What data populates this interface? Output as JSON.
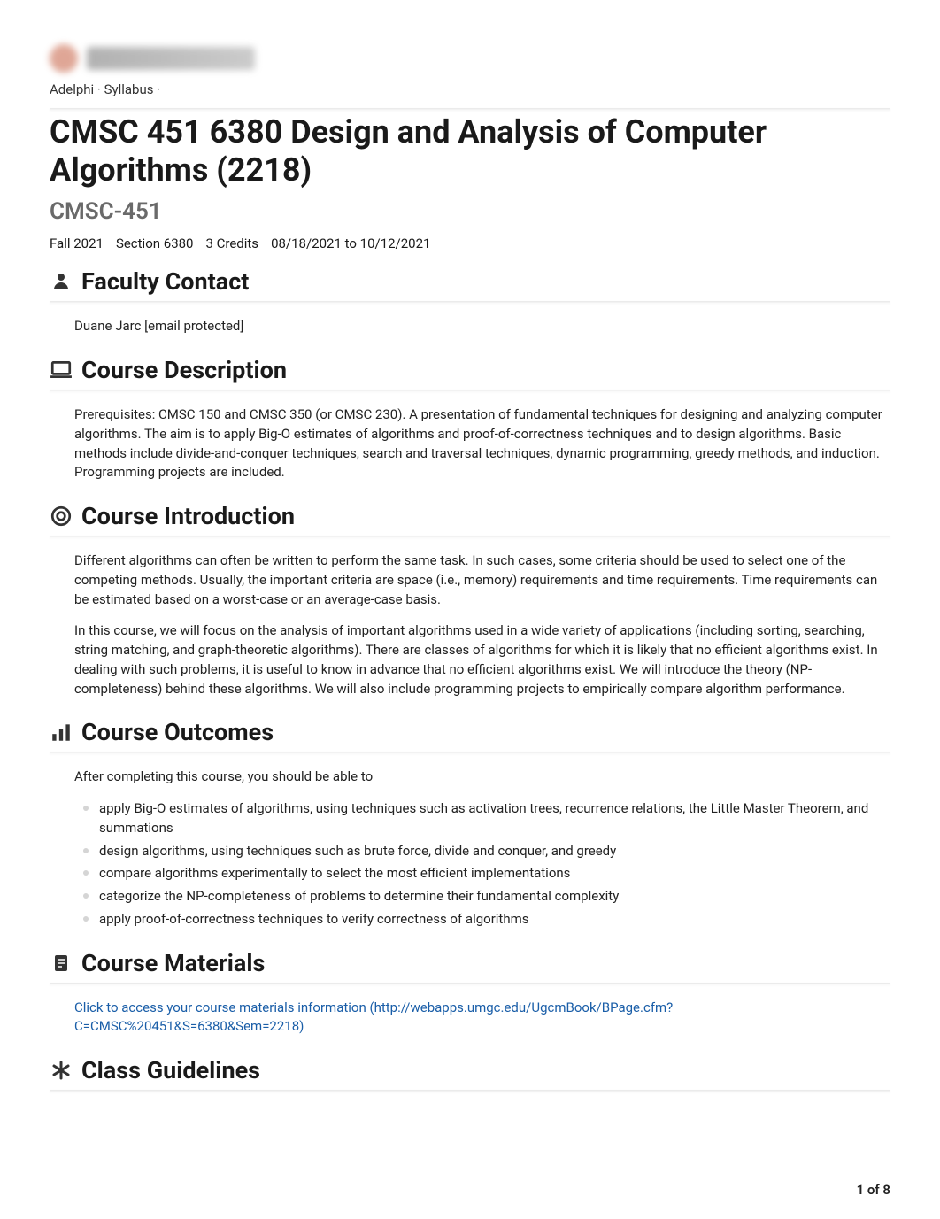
{
  "breadcrumb": {
    "part1": "Adelphi",
    "sep1": " · ",
    "part2": "Syllabus",
    "sep2": " · "
  },
  "header": {
    "course_title": "CMSC 451 6380 Design and Analysis of Computer Algorithms (2218)",
    "course_code": "CMSC-451",
    "term": "Fall 2021",
    "section": "Section 6380",
    "credits": "3 Credits",
    "dates": "08/18/2021 to 10/12/2021"
  },
  "sections": {
    "faculty_contact": {
      "title": "Faculty Contact",
      "body": "Duane Jarc [email protected]"
    },
    "course_description": {
      "title": "Course Description",
      "body": "Prerequisites: CMSC 150 and CMSC 350 (or CMSC 230). A presentation of fundamental techniques for designing and analyzing computer algorithms. The aim is to apply Big-O estimates of algorithms and proof-of-correctness techniques and to design algorithms. Basic methods include divide-and-conquer techniques, search and traversal techniques, dynamic programming, greedy methods, and induction. Programming projects are included."
    },
    "course_introduction": {
      "title": "Course Introduction",
      "p1": "Different algorithms can often be written to perform the same task. In such cases, some criteria should be used to select one of the competing methods. Usually, the important criteria are space (i.e., memory) requirements and time requirements. Time requirements can be estimated based on a worst-case or an average-case basis.",
      "p2": "In this course, we will focus on the analysis of important algorithms used in a wide variety of applications (including sorting, searching, string matching, and graph-theoretic algorithms). There are classes of algorithms for which it is likely that no efficient algorithms exist. In dealing with such problems, it is useful to know in advance that no efficient algorithms exist. We will introduce the theory (NP-completeness) behind these algorithms. We will also include programming projects to empirically compare algorithm performance."
    },
    "course_outcomes": {
      "title": "Course Outcomes",
      "intro": "After completing this course, you should be able to",
      "items": [
        "apply Big-O estimates of algorithms, using techniques such as activation trees, recurrence relations, the Little Master Theorem, and summations",
        "design algorithms, using techniques such as brute force, divide and conquer, and greedy",
        "compare algorithms experimentally to select the most efficient implementations",
        "categorize the NP-completeness of problems to determine their fundamental complexity",
        "apply proof-of-correctness techniques to verify correctness of algorithms"
      ]
    },
    "course_materials": {
      "title": "Course Materials",
      "link_text": "Click to access your course materials information (http://webapps.umgc.edu/UgcmBook/BPage.cfm?C=CMSC%20451&S=6380&Sem=2218)"
    },
    "class_guidelines": {
      "title": "Class Guidelines"
    }
  },
  "footer": {
    "page": "1 of 8"
  }
}
